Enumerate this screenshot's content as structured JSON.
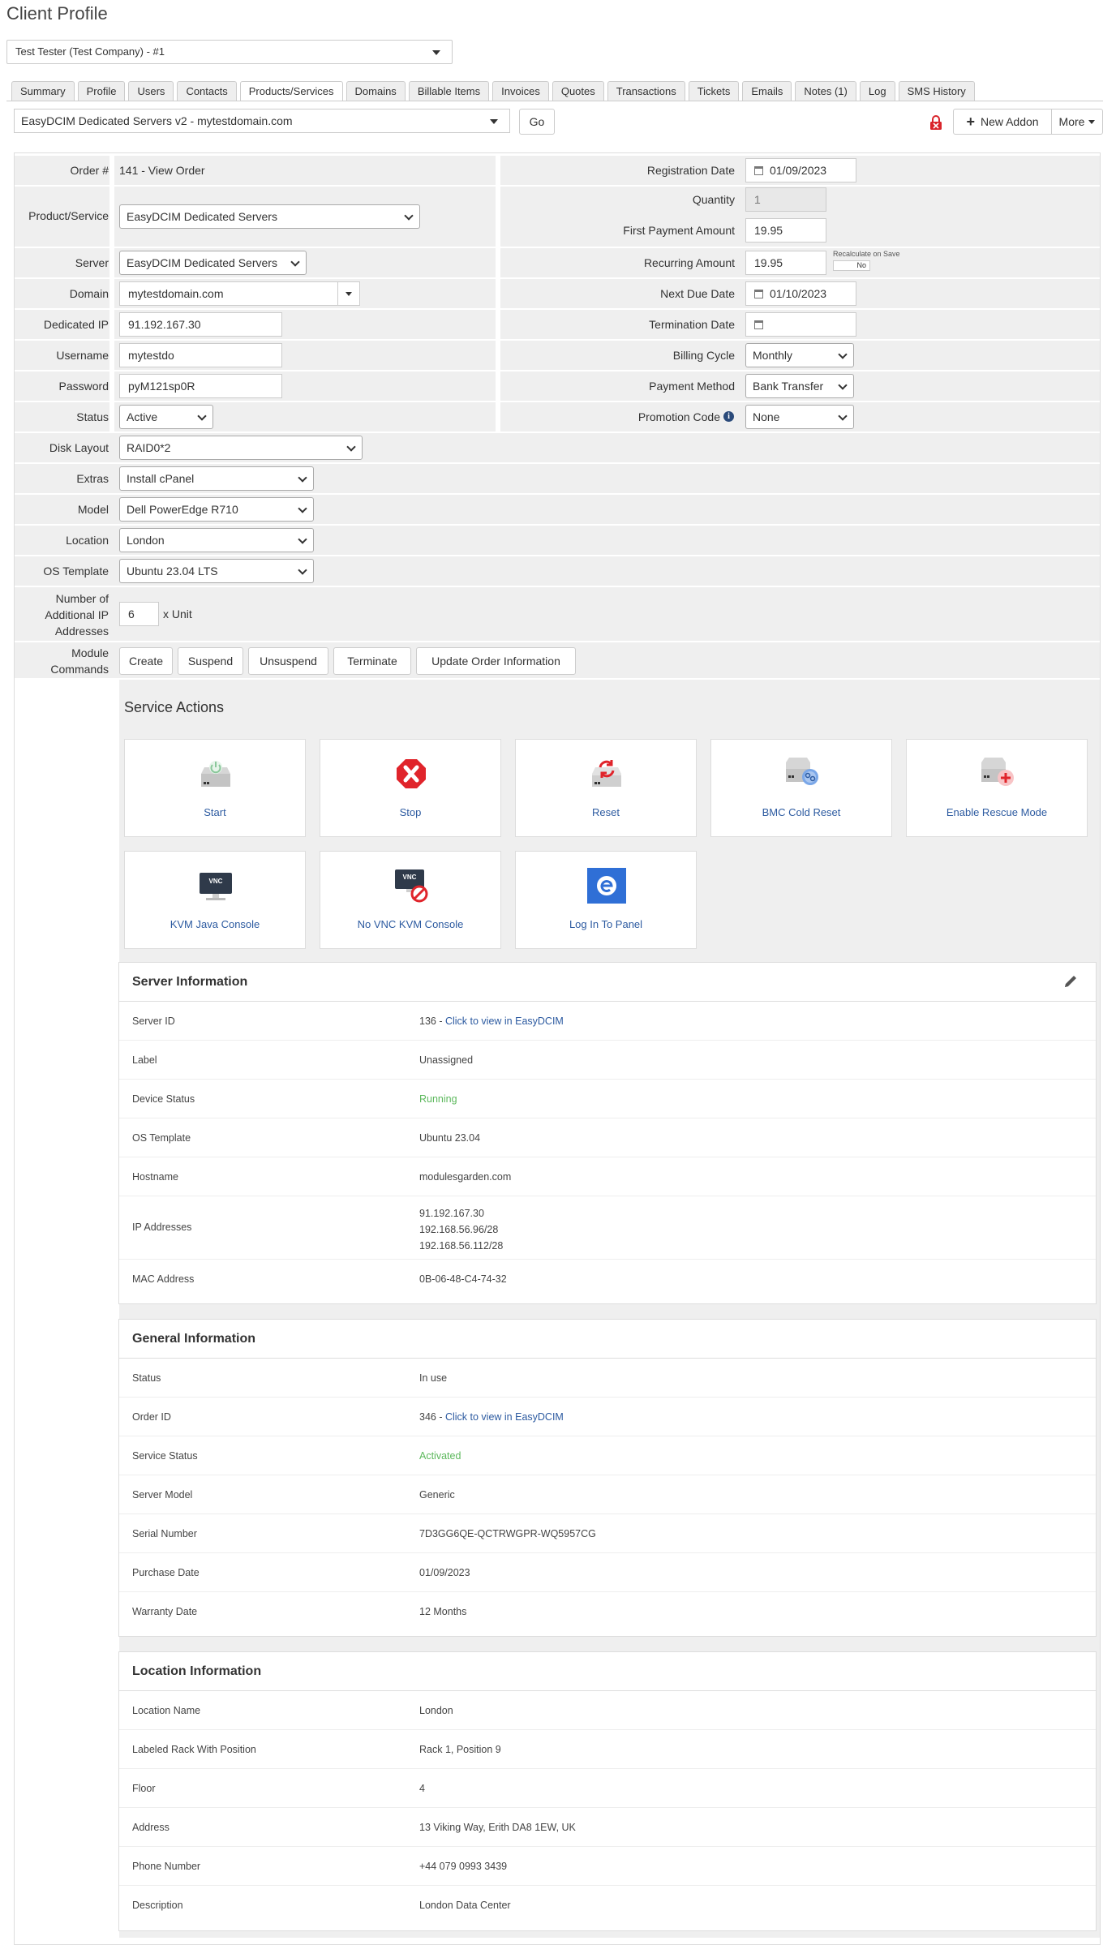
{
  "page": {
    "title": "Client Profile"
  },
  "client_selector": {
    "value": "Test Tester (Test Company) - #1"
  },
  "tabs": [
    "Summary",
    "Profile",
    "Users",
    "Contacts",
    "Products/Services",
    "Domains",
    "Billable Items",
    "Invoices",
    "Quotes",
    "Transactions",
    "Tickets",
    "Emails",
    "Notes (1)",
    "Log",
    "SMS History"
  ],
  "active_tab": "Products/Services",
  "toolbar": {
    "product_select": "EasyDCIM Dedicated Servers v2 - mytestdomain.com",
    "go": "Go",
    "new_addon": "New Addon",
    "more": "More"
  },
  "form": {
    "order_label": "Order #",
    "order_value": "141 - View Order",
    "product_label": "Product/Service",
    "product_value": "EasyDCIM Dedicated Servers",
    "server_label": "Server",
    "server_value": "EasyDCIM Dedicated Servers",
    "domain_label": "Domain",
    "domain_value": "mytestdomain.com",
    "ip_label": "Dedicated IP",
    "ip_value": "91.192.167.30",
    "username_label": "Username",
    "username_value": "mytestdo",
    "password_label": "Password",
    "password_value": "pyM121sp0R",
    "status_label": "Status",
    "status_value": "Active",
    "disk_label": "Disk Layout",
    "disk_value": "RAID0*2",
    "extras_label": "Extras",
    "extras_value": "Install cPanel",
    "model_label": "Model",
    "model_value": "Dell PowerEdge R710",
    "location_label": "Location",
    "location_value": "London",
    "os_label": "OS Template",
    "os_value": "Ubuntu 23.04 LTS",
    "addip_label_1": "Number of",
    "addip_label_2": "Additional IP",
    "addip_label_3": "Addresses",
    "addip_value": "6",
    "addip_unit": "x Unit",
    "modcmd_label_1": "Module",
    "modcmd_label_2": "Commands",
    "regdate_label": "Registration Date",
    "regdate_value": "01/09/2023",
    "qty_label": "Quantity",
    "qty_value": "1",
    "firstpay_label": "First Payment Amount",
    "firstpay_value": "19.95",
    "recurring_label": "Recurring Amount",
    "recurring_value": "19.95",
    "recalc_label": "Recalculate on Save",
    "recalc_toggle": "No",
    "nextdue_label": "Next Due Date",
    "nextdue_value": "01/10/2023",
    "termdate_label": "Termination Date",
    "termdate_value": "",
    "billing_label": "Billing Cycle",
    "billing_value": "Monthly",
    "paymethod_label": "Payment Method",
    "paymethod_value": "Bank Transfer",
    "promo_label": "Promotion Code",
    "promo_value": "None"
  },
  "module_commands": [
    "Create",
    "Suspend",
    "Unsuspend",
    "Terminate",
    "Update Order Information"
  ],
  "service_actions": {
    "title": "Service Actions",
    "tiles": [
      "Start",
      "Stop",
      "Reset",
      "BMC Cold Reset",
      "Enable Rescue Mode",
      "KVM Java Console",
      "No VNC KVM Console",
      "Log In To Panel"
    ],
    "vnc_badge": "VNC"
  },
  "server_info": {
    "title": "Server Information",
    "server_id_label": "Server ID",
    "server_id_num": "136 - ",
    "server_id_link": "Click to view in EasyDCIM",
    "label_label": "Label",
    "label_value": "Unassigned",
    "device_status_label": "Device Status",
    "device_status_value": "Running",
    "os_label": "OS Template",
    "os_value": "Ubuntu 23.04",
    "hostname_label": "Hostname",
    "hostname_value": "modulesgarden.com",
    "ips_label": "IP Addresses",
    "ips": [
      "91.192.167.30",
      "192.168.56.96/28",
      "192.168.56.112/28"
    ],
    "mac_label": "MAC Address",
    "mac_value": "0B-06-48-C4-74-32"
  },
  "general_info": {
    "title": "General Information",
    "status_label": "Status",
    "status_value": "In use",
    "order_label": "Order ID",
    "order_num": "346 - ",
    "order_link": "Click to view in EasyDCIM",
    "service_status_label": "Service Status",
    "service_status_value": "Activated",
    "model_label": "Server Model",
    "model_value": "Generic",
    "serial_label": "Serial Number",
    "serial_value": "7D3GG6QE-QCTRWGPR-WQ5957CG",
    "purchase_label": "Purchase Date",
    "purchase_value": "01/09/2023",
    "warranty_label": "Warranty Date",
    "warranty_value": "12 Months"
  },
  "location_info": {
    "title": "Location Information",
    "name_label": "Location Name",
    "name_value": "London",
    "rack_label": "Labeled Rack With Position",
    "rack_value": "Rack 1, Position 9",
    "floor_label": "Floor",
    "floor_value": "4",
    "address_label": "Address",
    "address_value": "13 Viking Way, Erith DA8 1EW, UK",
    "phone_label": "Phone Number",
    "phone_value": "+44 079 0993 3439",
    "desc_label": "Description",
    "desc_value": "London Data Center"
  },
  "colors": {
    "link": "#2c5aa0",
    "success": "#5cb85c",
    "row_bg": "#efefef",
    "danger": "#e0242b"
  }
}
